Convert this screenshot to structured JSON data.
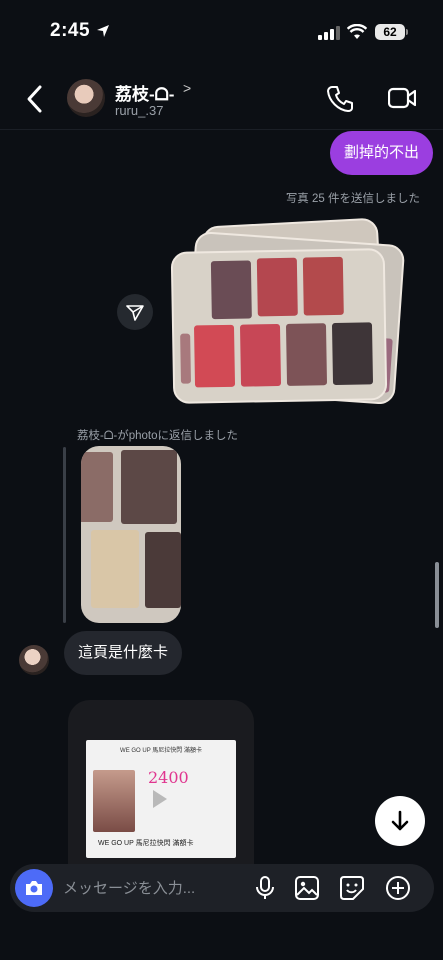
{
  "status_bar": {
    "time": "2:45",
    "battery": "62"
  },
  "header": {
    "contact_name": "荔枝-ᗝ-",
    "name_chevron": ">",
    "handle": "ruru_.37"
  },
  "messages": {
    "outgoing_text": "劃掉的不出",
    "sent_photos_notice": "写真 25 件を送信しました",
    "reply_notice": "荔枝-ᗝ-がphotoに返信しました",
    "incoming_text": "這頁是什麼卡"
  },
  "screenshot_preview": {
    "title": "WE GO UP 馬尼拉快閃 滿額卡",
    "price_scribble": "2400",
    "caption": "WE GO UP 馬尼拉快閃 滿額卡"
  },
  "composer": {
    "placeholder": "メッセージを入力..."
  },
  "colors": {
    "outgoing_bubble": "#9b3ee0",
    "camera_button": "#4d6bf7",
    "incoming_bubble": "#24272e"
  }
}
